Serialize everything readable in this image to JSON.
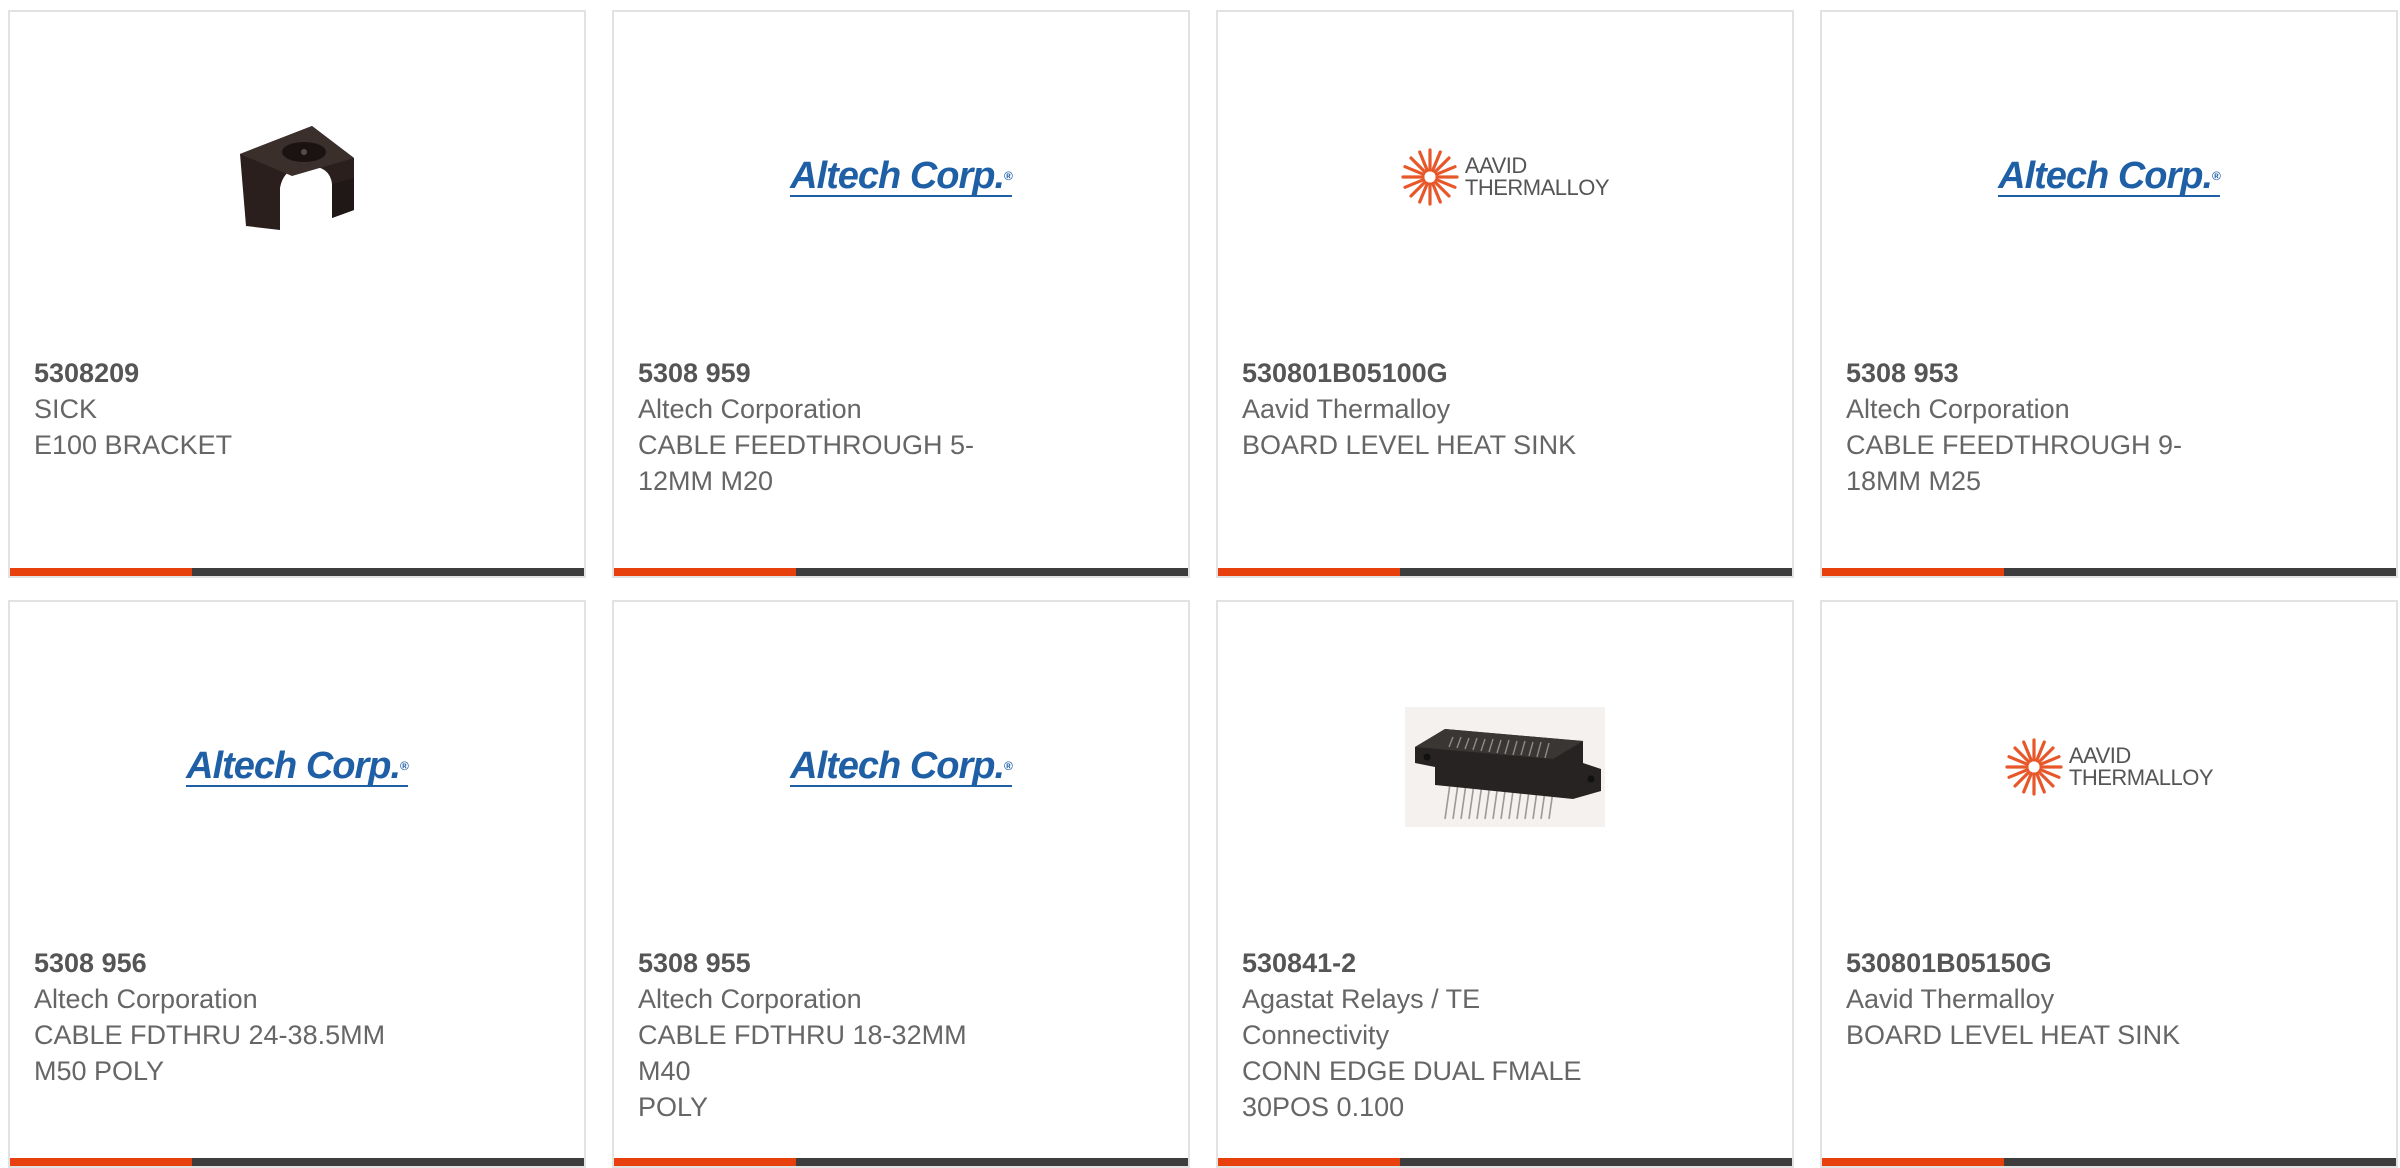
{
  "colors": {
    "accent": "#e8400c",
    "bar": "#3d3d3d",
    "card_border": "#e2e2e2",
    "text": "#666666",
    "altech_blue": "#1f5fa6",
    "aavid_orange": "#e8572a"
  },
  "products": [
    {
      "part_number": "5308209",
      "manufacturer": "SICK",
      "description_lines": [
        "E100 BRACKET"
      ],
      "image": "bracket-photo"
    },
    {
      "part_number": "5308 959",
      "manufacturer": "Altech Corporation",
      "description_lines": [
        "CABLE FEEDTHROUGH 5-",
        "12MM M20"
      ],
      "image": "altech-logo",
      "logo_text": "Altech Corp."
    },
    {
      "part_number": "530801B05100G",
      "manufacturer": "Aavid Thermalloy",
      "description_lines": [
        "BOARD LEVEL HEAT SINK"
      ],
      "image": "aavid-logo",
      "logo_lines": [
        "AAVID",
        "THERMALLOY"
      ]
    },
    {
      "part_number": "5308 953",
      "manufacturer": "Altech Corporation",
      "description_lines": [
        "CABLE FEEDTHROUGH 9-",
        "18MM M25"
      ],
      "image": "altech-logo",
      "logo_text": "Altech Corp."
    },
    {
      "part_number": "5308 956",
      "manufacturer": "Altech Corporation",
      "description_lines": [
        "CABLE FDTHRU 24-38.5MM",
        "M50 POLY"
      ],
      "image": "altech-logo",
      "logo_text": "Altech Corp."
    },
    {
      "part_number": "5308 955",
      "manufacturer": "Altech Corporation",
      "description_lines": [
        "CABLE FDTHRU 18-32MM M40",
        "POLY"
      ],
      "image": "altech-logo",
      "logo_text": "Altech Corp."
    },
    {
      "part_number": "530841-2",
      "manufacturer": "Agastat Relays / TE Connectivity",
      "description_lines": [
        "CONN EDGE DUAL FMALE",
        "30POS 0.100"
      ],
      "image": "connector-photo"
    },
    {
      "part_number": "530801B05150G",
      "manufacturer": "Aavid Thermalloy",
      "description_lines": [
        "BOARD LEVEL HEAT SINK"
      ],
      "image": "aavid-logo",
      "logo_lines": [
        "AAVID",
        "THERMALLOY"
      ]
    }
  ]
}
